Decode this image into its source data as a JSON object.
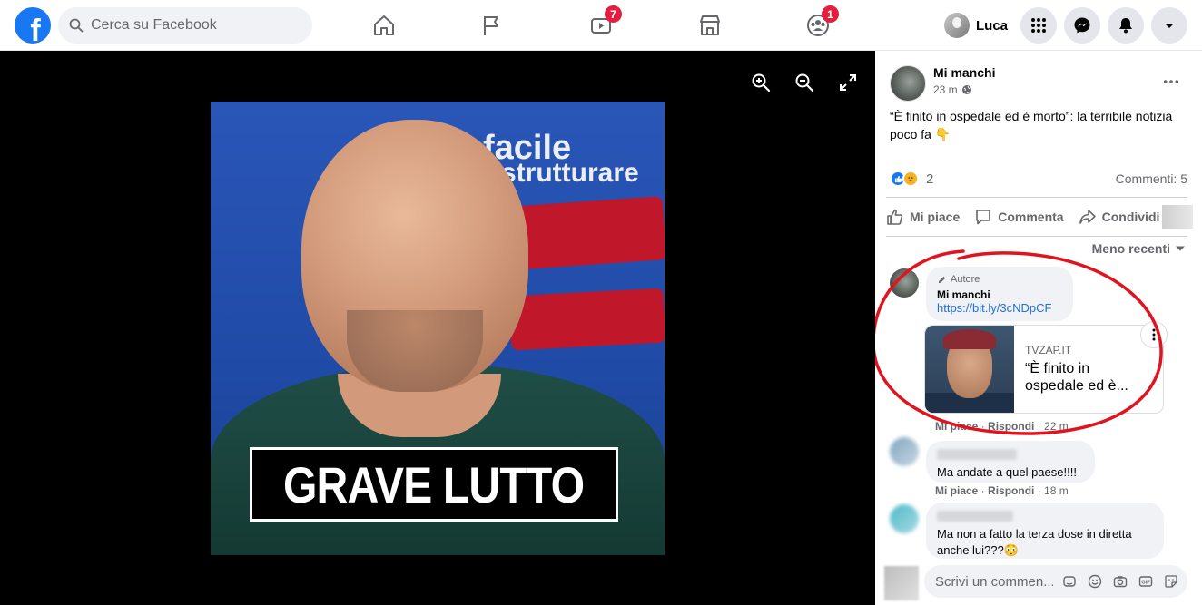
{
  "topbar": {
    "search_placeholder": "Cerca su Facebook",
    "video_badge": "7",
    "groups_badge": "1",
    "profile_name": "Luca"
  },
  "viewer": {
    "caption": "GRAVE LUTTO",
    "wall_text_1": "facile",
    "wall_text_2": "strutturare"
  },
  "post": {
    "author": "Mi manchi",
    "time": "23 m",
    "text": "“È finito in ospedale ed è morto”: la terribile notizia poco fa 👇",
    "reaction_count": "2",
    "comments_label": "Commenti: 5",
    "actions": {
      "like": "Mi piace",
      "comment": "Commenta",
      "share": "Condividi"
    },
    "sort_label": "Meno recenti"
  },
  "comments": [
    {
      "author_tag": "Autore",
      "name": "Mi manchi",
      "link": "https://bit.ly/3cNDpCF",
      "card": {
        "site": "TVZAP.IT",
        "title": "“È finito in ospedale ed è..."
      },
      "like_label": "Mi piace",
      "reply_label": "Rispondi",
      "time": "22 m"
    },
    {
      "text": "Ma andate a quel paese!!!!",
      "like_label": "Mi piace",
      "reply_label": "Rispondi",
      "time": "18 m"
    },
    {
      "text": "Ma non a fatto la terza dose in diretta anche lui???😳"
    }
  ],
  "write": {
    "placeholder": "Scrivi un commen..."
  },
  "colors": {
    "brand": "#1877f2",
    "badge": "#e41e3f",
    "annotation": "#e0141e"
  }
}
